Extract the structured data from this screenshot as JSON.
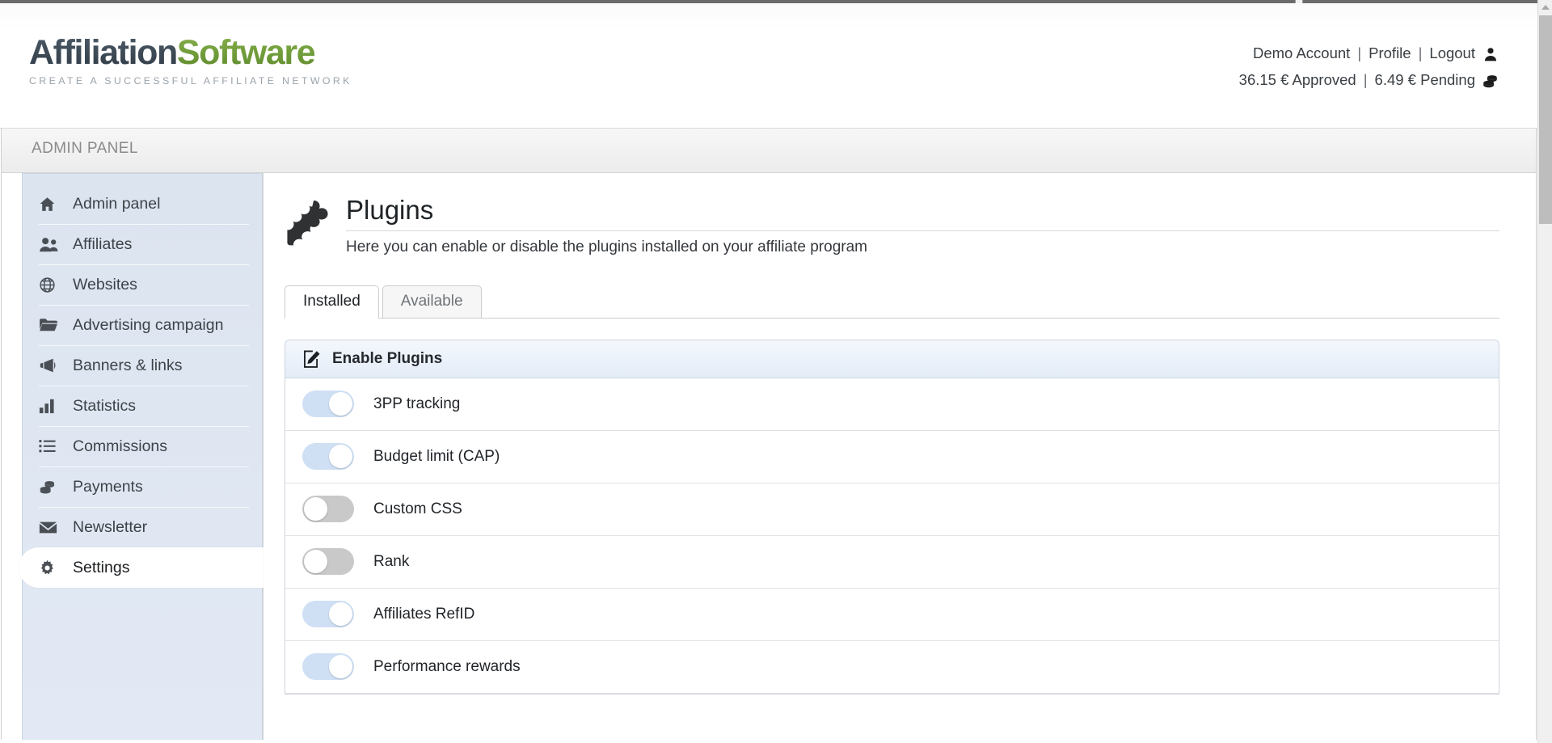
{
  "brand": {
    "logo_dark": "Affiliation",
    "logo_green": "Software",
    "tagline": "CREATE A SUCCESSFUL AFFILIATE NETWORK"
  },
  "colors": {
    "logo_dark": "#3d4b58",
    "logo_green": "#6e9e3a",
    "sidebar_bg": "#dce4f0",
    "toggle_on": "#cfe0f5",
    "toggle_off": "#c9c9c9",
    "panel_header": "#e4ecf7",
    "text": "#22262a"
  },
  "account": {
    "name": "Demo Account",
    "profile_label": "Profile",
    "logout_label": "Logout",
    "separator": "|",
    "approved": "36.15 € Approved",
    "pending": "6.49 € Pending",
    "user_icon": "user-icon",
    "coins_icon": "coins-icon"
  },
  "panel_strip": {
    "label": "ADMIN PANEL"
  },
  "sidebar": {
    "items": [
      {
        "label": "Admin panel",
        "icon": "home-icon",
        "active": false
      },
      {
        "label": "Affiliates",
        "icon": "users-icon",
        "active": false
      },
      {
        "label": "Websites",
        "icon": "globe-icon",
        "active": false
      },
      {
        "label": "Advertising campaign",
        "icon": "folder-icon",
        "active": false
      },
      {
        "label": "Banners & links",
        "icon": "megaphone-icon",
        "active": false
      },
      {
        "label": "Statistics",
        "icon": "bar-chart-icon",
        "active": false
      },
      {
        "label": "Commissions",
        "icon": "list-icon",
        "active": false
      },
      {
        "label": "Payments",
        "icon": "coins-icon",
        "active": false
      },
      {
        "label": "Newsletter",
        "icon": "envelope-icon",
        "active": false
      },
      {
        "label": "Settings",
        "icon": "gear-icon",
        "active": true
      }
    ]
  },
  "page": {
    "icon": "puzzle-piece-icon",
    "title": "Plugins",
    "subtitle": "Here you can enable or disable the plugins installed on your affiliate program"
  },
  "tabs": [
    {
      "label": "Installed",
      "active": true
    },
    {
      "label": "Available",
      "active": false
    }
  ],
  "plugins_panel": {
    "header_label": "Enable Plugins",
    "header_icon": "edit-document-icon",
    "rows": [
      {
        "label": "3PP tracking",
        "enabled": true
      },
      {
        "label": "Budget limit (CAP)",
        "enabled": true
      },
      {
        "label": "Custom CSS",
        "enabled": false
      },
      {
        "label": "Rank",
        "enabled": false
      },
      {
        "label": "Affiliates RefID",
        "enabled": true
      },
      {
        "label": "Performance rewards",
        "enabled": true
      }
    ]
  },
  "scrollbar": {
    "up_arrow_icon": "chevron-up-icon"
  }
}
